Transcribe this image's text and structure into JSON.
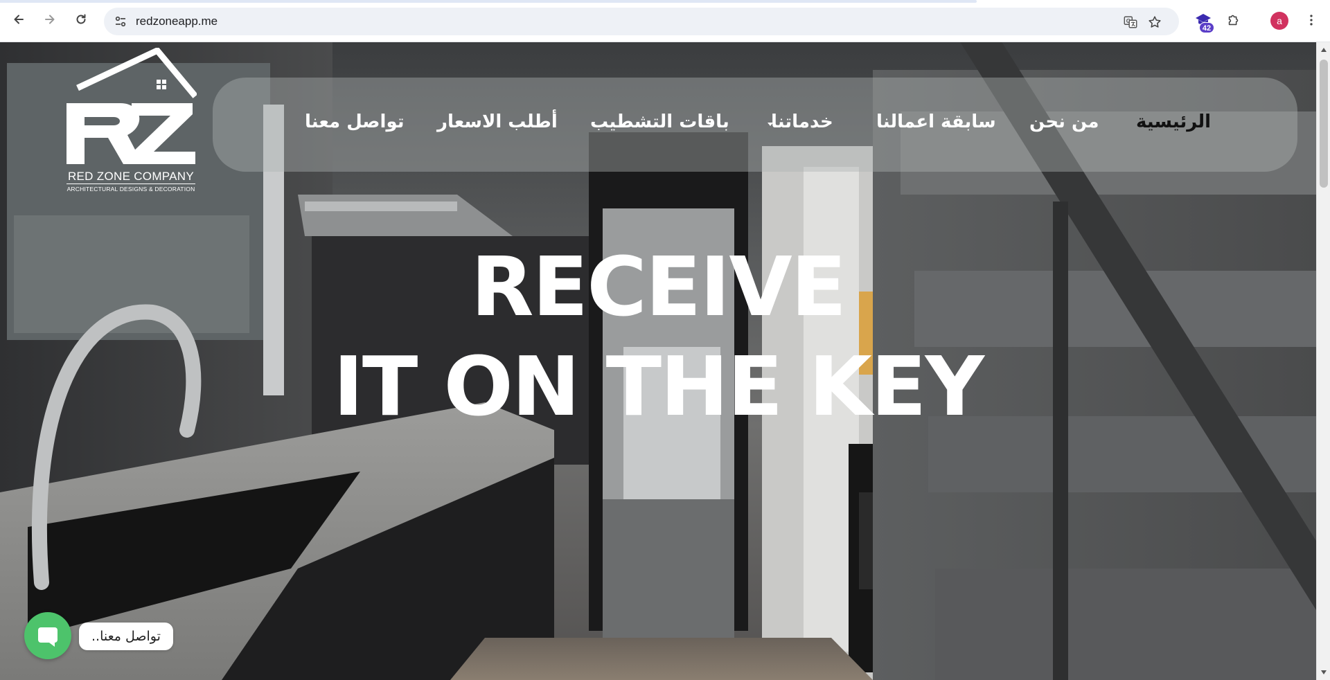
{
  "browser": {
    "url": "redzoneapp.me",
    "extension_badge": "42",
    "profile_initial": "a",
    "icons": {
      "back": "back-arrow-icon",
      "forward": "forward-arrow-icon",
      "reload": "reload-icon",
      "site_info": "tune-icon",
      "translate": "translate-icon",
      "bookmark": "star-icon",
      "extension": "graduation-cap-icon",
      "extensions": "puzzle-icon",
      "menu": "kebab-menu-icon"
    }
  },
  "site": {
    "logo": {
      "letters": "RZ",
      "name": "RED ZONE COMPANY",
      "tagline": "ARCHITECTURAL DESIGNS & DECORATION"
    },
    "nav": {
      "home": "الرئيسية",
      "about": "من نحن",
      "portfolio": "سابقة اعمالنا",
      "services": "خدماتنا",
      "packages": "باقات التشطيب",
      "pricing": "أطلب الاسعار",
      "contact": "تواصل معنا"
    },
    "hero": {
      "line1": "RECEIVE",
      "line2": "IT ON THE KEY"
    },
    "chat_widget": {
      "label": "تواصل معنا..",
      "icon": "chat-bubble-icon"
    }
  },
  "colors": {
    "nav_active": "#111111",
    "nav_text": "#ffffff",
    "chat_button": "#4dc36b",
    "profile": "#d1325f",
    "badge": "#5b3ec8"
  }
}
